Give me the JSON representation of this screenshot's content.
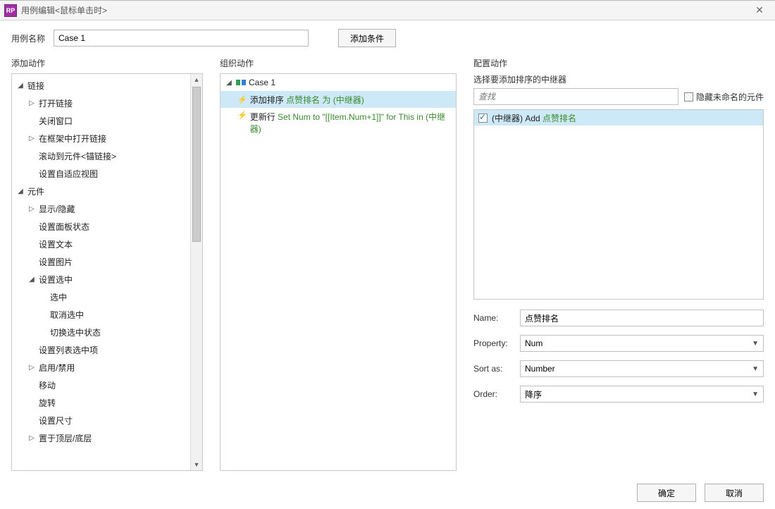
{
  "title": "用例编辑<鼠标单击时>",
  "case_name_label": "用例名称",
  "case_name_value": "Case 1",
  "add_condition_label": "添加条件",
  "columns": {
    "add_action": "添加动作",
    "organize_action": "组织动作",
    "configure_action": "配置动作"
  },
  "action_tree": {
    "links": {
      "label": "链接",
      "open_link": "打开链接",
      "close_window": "关闭窗口",
      "open_in_frame": "在框架中打开链接",
      "scroll_to_anchor": "滚动到元件<锚链接>",
      "set_adaptive": "设置自适应视图"
    },
    "widgets": {
      "label": "元件",
      "show_hide": "显示/隐藏",
      "panel_state": "设置面板状态",
      "set_text": "设置文本",
      "set_image": "设置图片",
      "set_selected": {
        "label": "设置选中",
        "select": "选中",
        "unselect": "取消选中",
        "toggle": "切换选中状态"
      },
      "set_list_selected": "设置列表选中项",
      "enable_disable": "启用/禁用",
      "move": "移动",
      "rotate": "旋转",
      "set_size": "设置尺寸",
      "bring_front_back": "置于顶层/底层"
    }
  },
  "organize": {
    "case_label": "Case 1",
    "item1_pre": "添加排序 ",
    "item1_green": "点赞排名 为 (中继器)",
    "item2_pre": "更新行 ",
    "item2_green1": "Set Num to \"[[Item.Num+1]]\" for This in (中继器)"
  },
  "config": {
    "header": "选择要添加排序的中继器",
    "search_placeholder": "查找",
    "hide_unnamed": "隐藏未命名的元件",
    "repeater_pre": "(中继器) Add ",
    "repeater_green": "点赞排名",
    "name_label": "Name:",
    "name_value": "点赞排名",
    "property_label": "Property:",
    "property_value": "Num",
    "sortas_label": "Sort as:",
    "sortas_value": "Number",
    "order_label": "Order:",
    "order_value": "降序"
  },
  "footer": {
    "ok": "确定",
    "cancel": "取消"
  }
}
